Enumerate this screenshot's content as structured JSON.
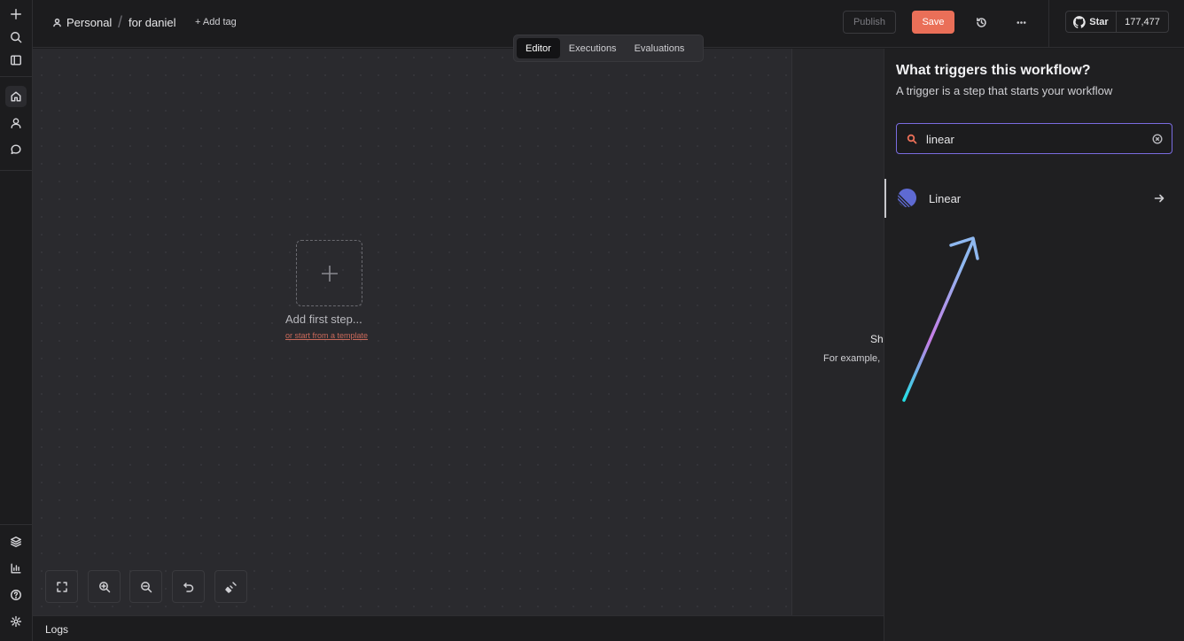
{
  "header": {
    "project": "Personal",
    "workflow_name": "for daniel",
    "add_tag": "+ Add tag",
    "publish_label": "Publish",
    "save_label": "Save",
    "github_star_label": "Star",
    "github_star_count": "177,477"
  },
  "tabs": [
    {
      "label": "Editor",
      "active": true
    },
    {
      "label": "Executions",
      "active": false
    },
    {
      "label": "Evaluations",
      "active": false
    }
  ],
  "canvas": {
    "add_first_step": "Add first step...",
    "template_link": "or start from a template",
    "partial_title": "Sh",
    "partial_desc": "For example,"
  },
  "logs_label": "Logs",
  "trigger_panel": {
    "title": "What triggers this workflow?",
    "subtitle": "A trigger is a step that starts your workflow",
    "search_value": "linear",
    "results": [
      {
        "label": "Linear",
        "icon": "linear-logo-icon"
      }
    ]
  },
  "colors": {
    "accent_save": "#ea6f58",
    "search_border": "#7a6ce0",
    "canvas_bg": "#2a2a2e"
  }
}
